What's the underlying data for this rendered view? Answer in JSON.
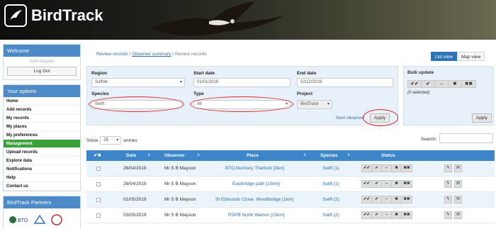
{
  "app": {
    "title": "BirdTrack"
  },
  "sidebar": {
    "welcome_title": "Welcome",
    "user_name": "Scott Mayson",
    "logout_label": "Log Out",
    "options_title": "Your options",
    "options": [
      "Home",
      "Add records",
      "My records",
      "My places",
      "My preferences",
      "Management",
      "Upload records",
      "Explore data",
      "Notifications",
      "Help",
      "Contact us"
    ],
    "active_option": "Management",
    "partners_title": "BirdTrack Partners"
  },
  "breadcrumb": {
    "item1": "Review records",
    "sep": "/",
    "item2": "Observer summary",
    "item3": "Review records"
  },
  "view_toggle": {
    "list": "List view",
    "map": "Map view"
  },
  "filters": {
    "region_label": "Region",
    "region_value": "Suffolk",
    "start_label": "Start date",
    "start_value": "01/01/2019",
    "end_label": "End date",
    "end_value": "02/12/2019",
    "species_label": "Species",
    "species_value": "Swift",
    "type_label": "Type",
    "type_value": "All",
    "project_label": "Project",
    "project_value": "BirdTrack",
    "next_observer": "Next observer",
    "apply": "Apply"
  },
  "bulk": {
    "title": "Bulk update",
    "icons": [
      "✔✔",
      "✔",
      "–",
      "✖",
      "✖✖"
    ],
    "selected": "(0 selected)",
    "apply": "Apply"
  },
  "table_controls": {
    "show": "Show",
    "length": "25",
    "entries": "entries",
    "search_label": "Search:"
  },
  "table": {
    "header_check": "✔✖",
    "columns": [
      "Date",
      "Observer",
      "Place",
      "Species",
      "Status"
    ],
    "status_icons": [
      "✔✔",
      "✔",
      "–",
      "✖",
      "✖✖"
    ],
    "rows": [
      {
        "date": "26/04/2019",
        "observer": "Mr S B Mayson",
        "place": "BTO,Nunnery Thetford [2km]",
        "species": "Swift (1)"
      },
      {
        "date": "28/04/2019",
        "observer": "Mr S B Mayson",
        "place": "Eastbridge path [10km]",
        "species": "Swift (1)"
      },
      {
        "date": "01/05/2019",
        "observer": "Mr S B Mayson",
        "place": "St Edmunds Close, Woodbridge [1km]",
        "species": "Swift (2)"
      },
      {
        "date": "03/05/2019",
        "observer": "Mr S B Mayson",
        "place": "RSPB North Warren [10km]",
        "species": "Swift (2)"
      }
    ]
  },
  "colors": {
    "accent": "#3f85c9",
    "active_menu": "#3aa13a",
    "highlight_ring": "#e0232a"
  }
}
